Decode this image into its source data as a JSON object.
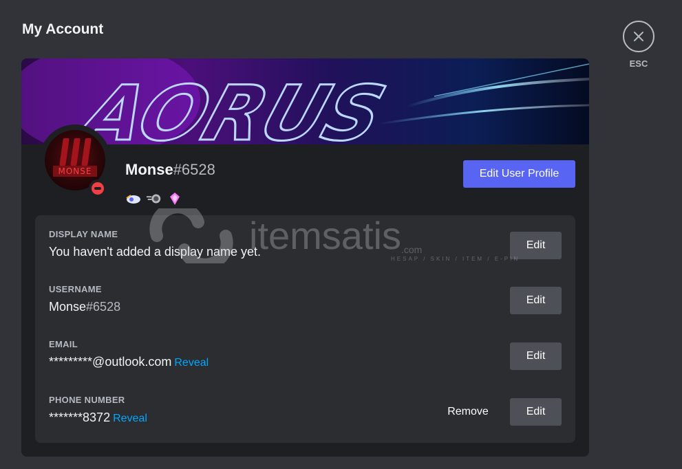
{
  "page": {
    "title": "My Account"
  },
  "close": {
    "esc_label": "ESC",
    "icon": "close-icon"
  },
  "banner": {
    "text": "AORUS"
  },
  "avatar": {
    "text": "MONSE",
    "status": "do-not-disturb",
    "status_color": "#f23f43"
  },
  "profile": {
    "username": "Monse",
    "discriminator": "#6528",
    "badges": [
      "hypesquad-icon",
      "nitro-icon",
      "boost-gem-icon"
    ],
    "edit_profile_label": "Edit User Profile"
  },
  "fields": {
    "display_name": {
      "label": "DISPLAY NAME",
      "value": "You haven't added a display name yet.",
      "edit_label": "Edit"
    },
    "username": {
      "label": "USERNAME",
      "value": "Monse",
      "discriminator": "#6528",
      "edit_label": "Edit"
    },
    "email": {
      "label": "EMAIL",
      "value": "*********@outlook.com",
      "reveal_label": "Reveal",
      "edit_label": "Edit"
    },
    "phone": {
      "label": "PHONE NUMBER",
      "value": "*******8372",
      "reveal_label": "Reveal",
      "remove_label": "Remove",
      "edit_label": "Edit"
    }
  },
  "watermark": {
    "text": "itemsatis",
    "sub": "HESAP / SKIN / ITEM / E-PIN",
    "suffix": ".com"
  },
  "colors": {
    "accent": "#5865f2",
    "link": "#00a8fc",
    "background": "#313338",
    "card": "#1e1f22",
    "panel": "#2b2d31"
  }
}
